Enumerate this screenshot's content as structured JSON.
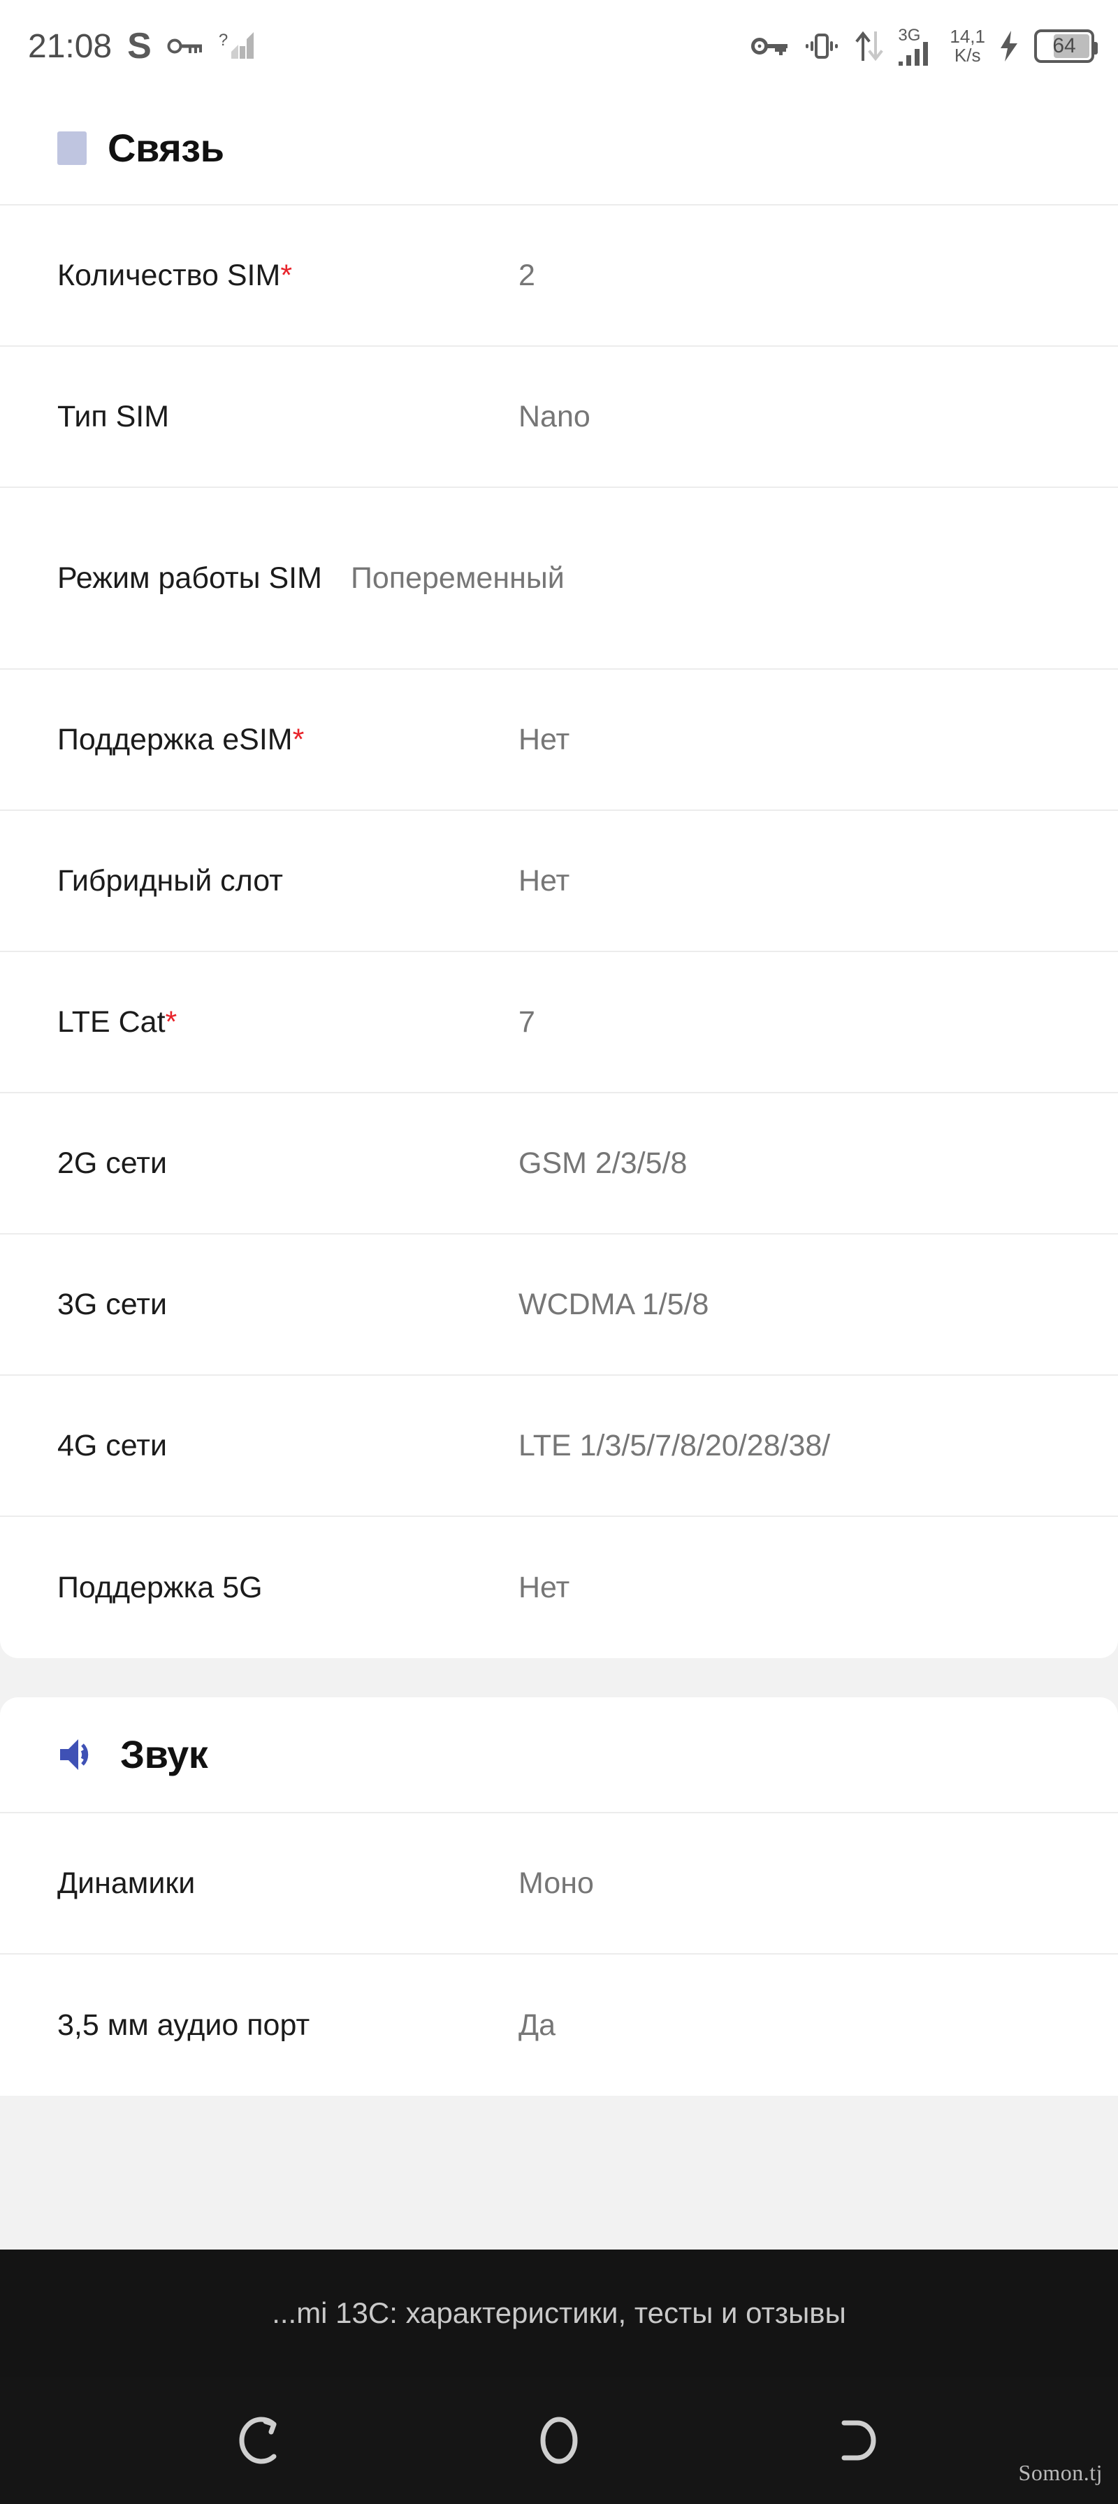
{
  "status_bar": {
    "time": "21:08",
    "letter_indicator": "S",
    "icons_left": [
      "key-icon",
      "signal-unknown-icon"
    ],
    "icons_right": [
      "key-icon",
      "vibrate-icon",
      "data-transfer-icon",
      "signal-bars-icon",
      "charging-bolt-icon"
    ],
    "network_generation": "3G",
    "net_speed_value": "14,1",
    "net_speed_unit": "K/s",
    "battery_percent": "64",
    "signal_unknown_label": "?"
  },
  "sections": [
    {
      "id": "svyaz",
      "title": "Связь",
      "icon": "square-icon",
      "icon_color": "#bfc5e0",
      "rows": [
        {
          "key": "Количество SIM",
          "required": "*",
          "value": "2"
        },
        {
          "key": "Тип SIM",
          "required": "",
          "value": "Nano"
        },
        {
          "key": "Режим работы SIM",
          "required": "",
          "value": "Попеременный",
          "two_line": true
        },
        {
          "key": "Поддержка eSIM",
          "required": "*",
          "value": "Нет"
        },
        {
          "key": "Гибридный слот",
          "required": "",
          "value": "Нет"
        },
        {
          "key": "LTE Cat",
          "required": "*",
          "value": "7"
        },
        {
          "key": "2G сети",
          "required": "",
          "value": "GSM 2/3/5/8"
        },
        {
          "key": "3G сети",
          "required": "",
          "value": "WCDMA 1/5/8"
        },
        {
          "key": "4G сети",
          "required": "",
          "value": "LTE 1/3/5/7/8/20/28/38/"
        },
        {
          "key": "Поддержка 5G",
          "required": "",
          "value": "Нет"
        }
      ]
    },
    {
      "id": "zvuk",
      "title": "Звук",
      "icon": "speaker-icon",
      "icon_color": "#3f51b5",
      "rows": [
        {
          "key": "Динамики",
          "required": "",
          "value": "Моно"
        },
        {
          "key": "3,5 мм аудио порт",
          "required": "",
          "value": "Да"
        }
      ]
    }
  ],
  "overlay": {
    "text": "...mi 13C: характеристики, тесты и отзывы"
  },
  "nav_bar": {
    "buttons": [
      "recents-icon",
      "home-icon",
      "back-icon"
    ],
    "watermark": "Somon.tj"
  },
  "colors": {
    "accent_red": "#e8232a",
    "page_bg": "#f2f2f2",
    "card_bg": "#ffffff",
    "divider": "#ececec",
    "value_text": "#767676",
    "key_text": "#1b1b1b"
  }
}
